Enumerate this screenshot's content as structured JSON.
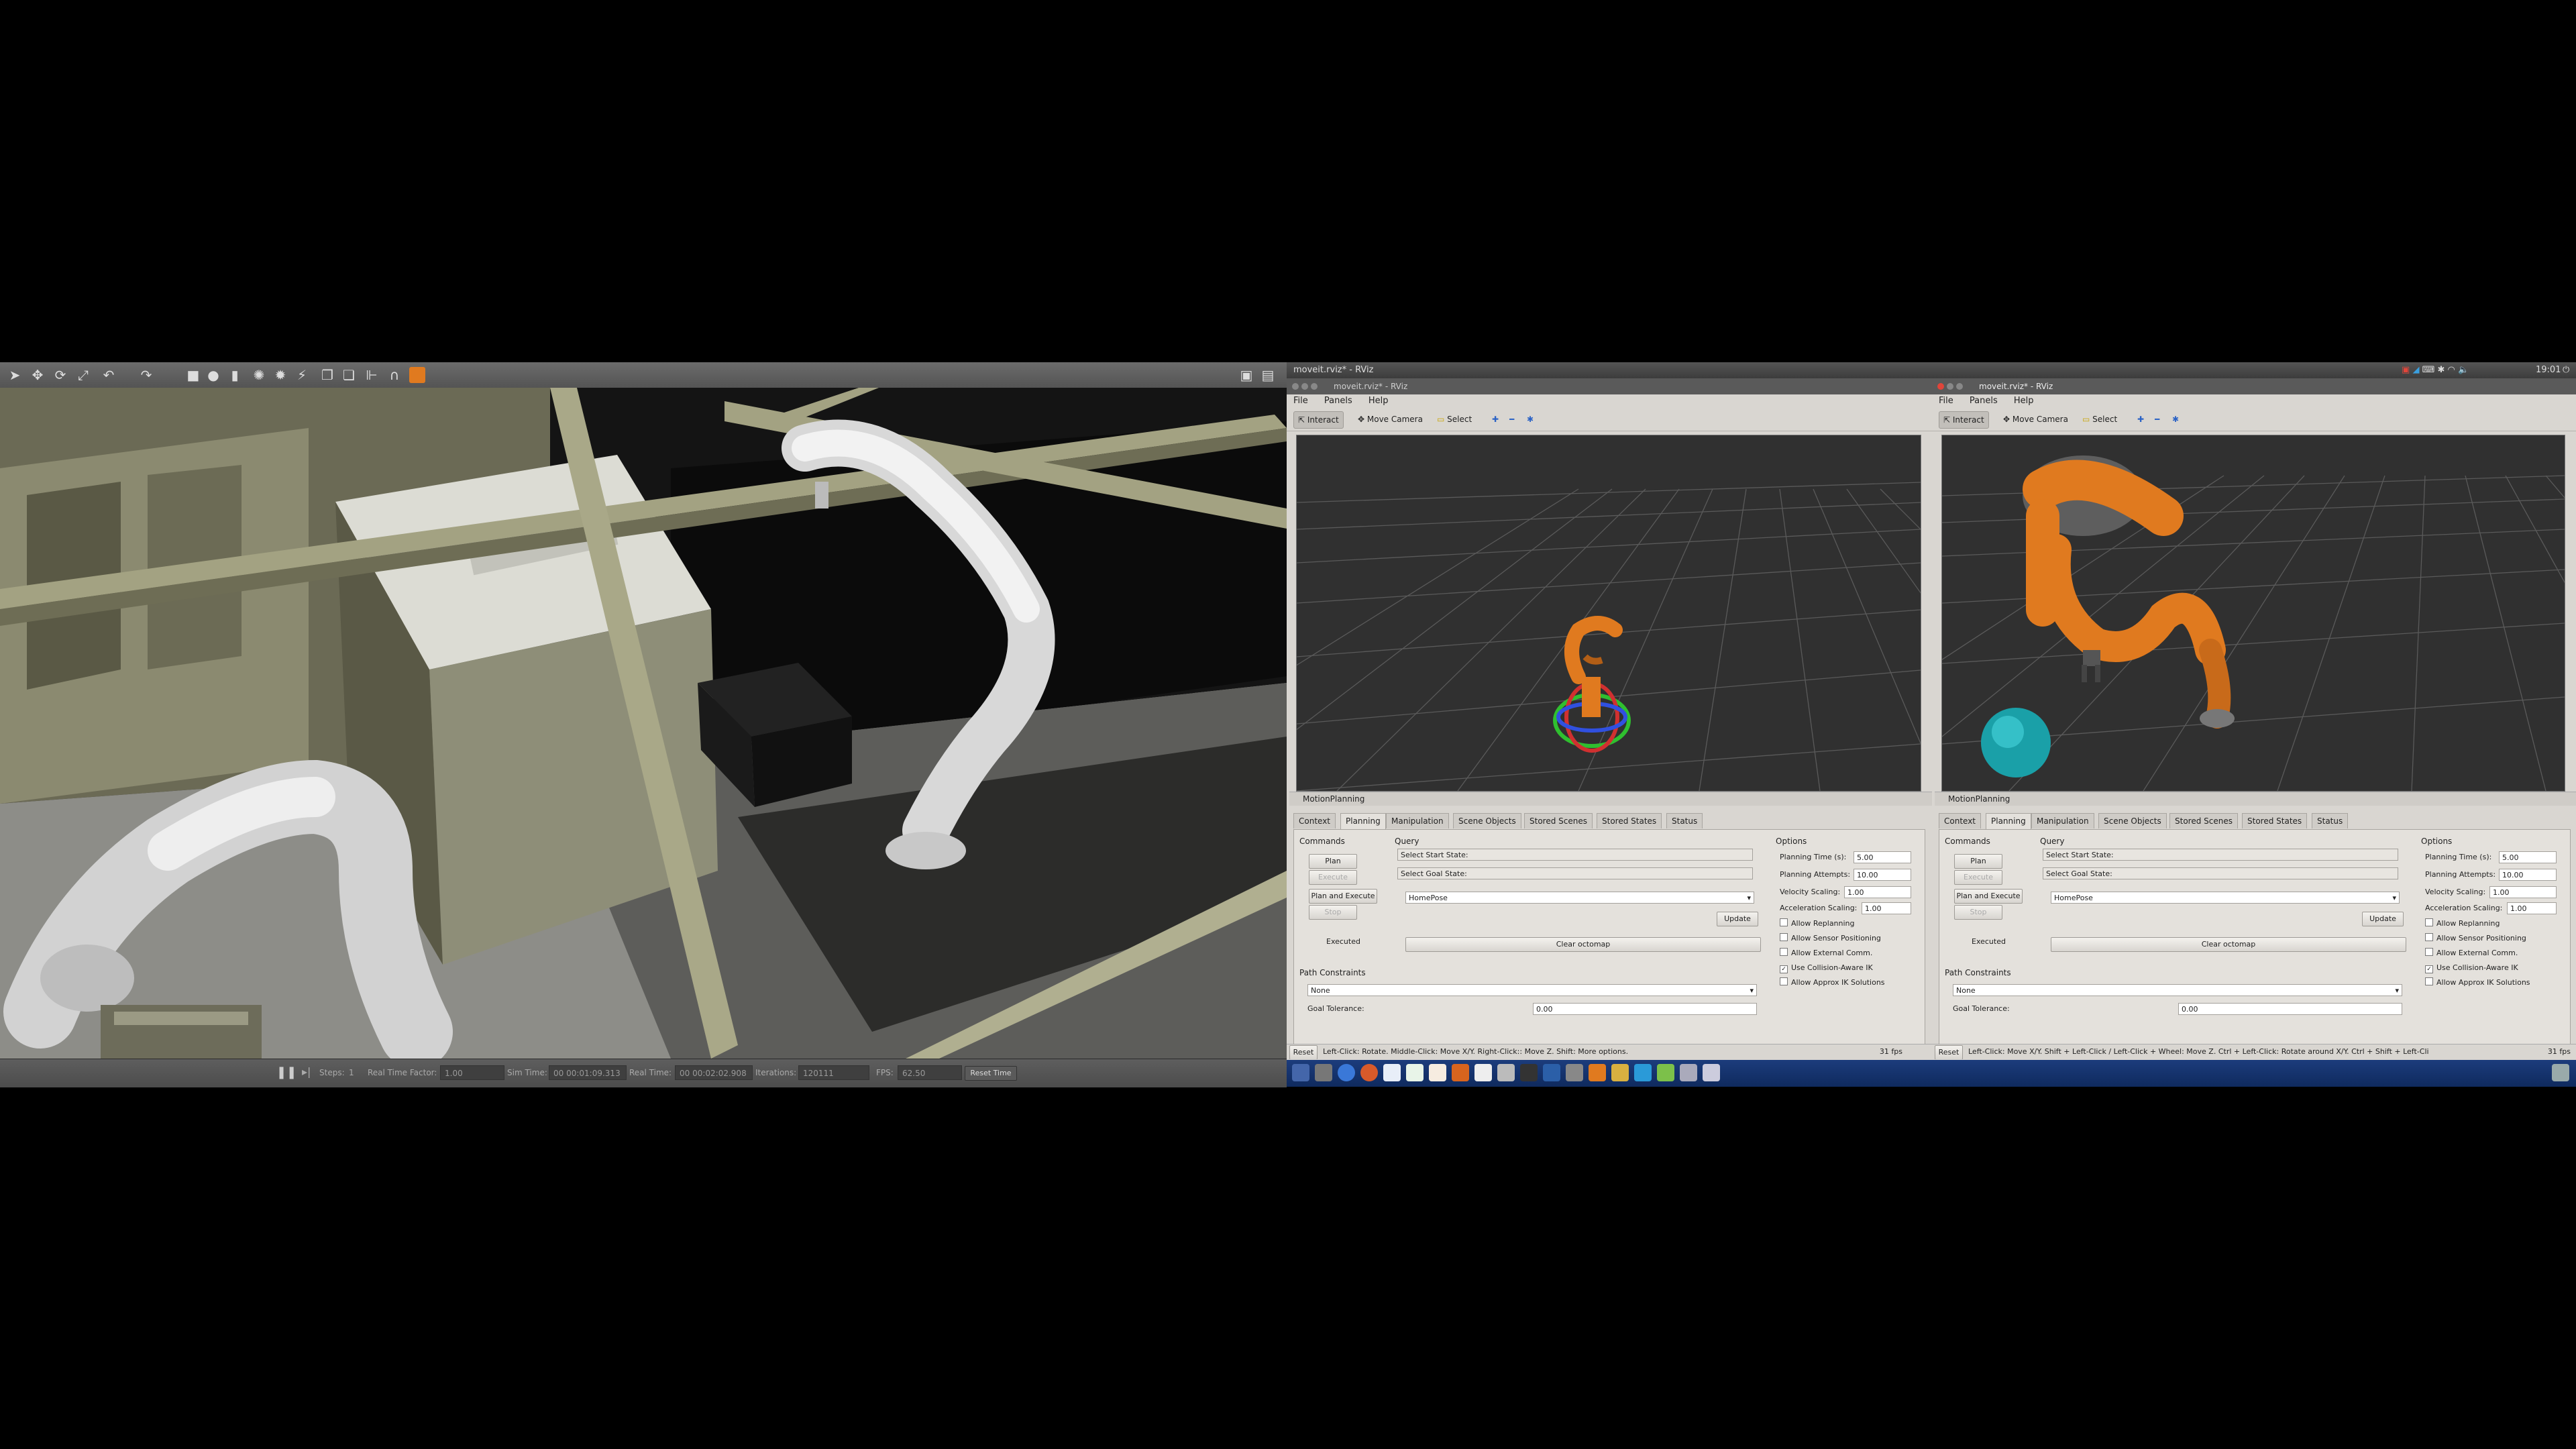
{
  "gazebo": {
    "toolbar_icons": [
      "pointer-icon",
      "translate-icon",
      "rotate-icon",
      "scale-icon",
      "undo-icon",
      "redo-icon",
      "box-icon",
      "sphere-icon",
      "cylinder-icon",
      "point-light-icon",
      "spot-light-icon",
      "directional-light-icon",
      "copy-icon",
      "paste-icon",
      "align-icon",
      "snap-icon",
      "screenshot-icon",
      "record-icon"
    ],
    "bottom": {
      "steps_label": "Steps:",
      "steps_value": "1",
      "rtf_label": "Real Time Factor:",
      "rtf_value": "1.00",
      "sim_time_label": "Sim Time:",
      "sim_time_value": "00 00:01:09.313",
      "real_time_label": "Real Time:",
      "real_time_value": "00 00:02:02.908",
      "iterations_label": "Iterations:",
      "iterations_value": "120111",
      "fps_label": "FPS:",
      "fps_value": "62.50",
      "reset_time": "Reset Time"
    }
  },
  "rviz_left": {
    "window_title": "moveit.rviz* - RViz",
    "inner_title": "moveit.rviz* - RViz",
    "menu": [
      "File",
      "Panels",
      "Help"
    ],
    "toolbar": [
      "Interact",
      "Move Camera",
      "Select"
    ],
    "panel_title": "MotionPlanning",
    "tabs": [
      "Context",
      "Planning",
      "Manipulation",
      "Scene Objects",
      "Stored Scenes",
      "Stored States",
      "Status"
    ],
    "commands_label": "Commands",
    "plan": "Plan",
    "execute": "Execute",
    "plan_execute": "Plan and Execute",
    "stop": "Stop",
    "executed": "Executed",
    "query_label": "Query",
    "start_state": "Select Start State:",
    "goal_state": "Select Goal State:",
    "goal_value": "HomePose",
    "update": "Update",
    "clear_octomap": "Clear octomap",
    "options_label": "Options",
    "planning_time_label": "Planning Time (s):",
    "planning_time": "5.00",
    "planning_attempts_label": "Planning Attempts:",
    "planning_attempts": "10.00",
    "velocity_label": "Velocity Scaling:",
    "velocity": "1.00",
    "accel_label": "Acceleration Scaling:",
    "accel": "1.00",
    "checks": [
      {
        "label": "Allow Replanning",
        "checked": false
      },
      {
        "label": "Allow Sensor Positioning",
        "checked": false
      },
      {
        "label": "Allow External Comm.",
        "checked": false
      },
      {
        "label": "Use Collision-Aware IK",
        "checked": true
      },
      {
        "label": "Allow Approx IK Solutions",
        "checked": false
      }
    ],
    "path_constraints_label": "Path Constraints",
    "path_constraints_value": "None",
    "goal_tolerance_label": "Goal Tolerance:",
    "goal_tolerance": "0.00",
    "status_reset": "Reset",
    "status_text": "Left-Click: Rotate. Middle-Click: Move X/Y. Right-Click:: Move Z. Shift: More options.",
    "fps": "31 fps"
  },
  "rviz_right": {
    "inner_title": "moveit.rviz* - RViz",
    "menu": [
      "File",
      "Panels",
      "Help"
    ],
    "toolbar": [
      "Interact",
      "Move Camera",
      "Select"
    ],
    "panel_title": "MotionPlanning",
    "tabs": [
      "Context",
      "Planning",
      "Manipulation",
      "Scene Objects",
      "Stored Scenes",
      "Stored States",
      "Status"
    ],
    "commands_label": "Commands",
    "plan": "Plan",
    "execute": "Execute",
    "plan_execute": "Plan and Execute",
    "stop": "Stop",
    "executed": "Executed",
    "query_label": "Query",
    "start_state": "Select Start State:",
    "goal_state": "Select Goal State:",
    "goal_value": "HomePose",
    "update": "Update",
    "clear_octomap": "Clear octomap",
    "options_label": "Options",
    "planning_time_label": "Planning Time (s):",
    "planning_time": "5.00",
    "planning_attempts_label": "Planning Attempts:",
    "planning_attempts": "10.00",
    "velocity_label": "Velocity Scaling:",
    "velocity": "1.00",
    "accel_label": "Acceleration Scaling:",
    "accel": "1.00",
    "checks": [
      {
        "label": "Allow Replanning",
        "checked": false
      },
      {
        "label": "Allow Sensor Positioning",
        "checked": false
      },
      {
        "label": "Allow External Comm.",
        "checked": false
      },
      {
        "label": "Use Collision-Aware IK",
        "checked": true
      },
      {
        "label": "Allow Approx IK Solutions",
        "checked": false
      }
    ],
    "path_constraints_label": "Path Constraints",
    "path_constraints_value": "None",
    "goal_tolerance_label": "Goal Tolerance:",
    "goal_tolerance": "0.00",
    "status_reset": "Reset",
    "status_text": "Left-Click: Move X/Y. Shift + Left-Click / Left-Click + Wheel: Move Z. Ctrl + Left-Click: Rotate around X/Y. Ctrl + Shift + Left-Cli",
    "fps": "31 fps"
  },
  "system_tray": {
    "clock": "19:01"
  },
  "taskbar_icons": [
    "ubuntu-dash-icon",
    "files-icon",
    "chrome-icon",
    "firefox-icon",
    "libreoffice-writer-icon",
    "libreoffice-calc-icon",
    "libreoffice-impress-icon",
    "software-center-icon",
    "amazon-icon",
    "settings-icon",
    "terminal-icon",
    "rviz-icon",
    "gazebo-icon",
    "text-editor-icon",
    "sublime-icon",
    "telegram-icon",
    "qt-icon",
    "workspace-icon",
    "trash-icon"
  ]
}
